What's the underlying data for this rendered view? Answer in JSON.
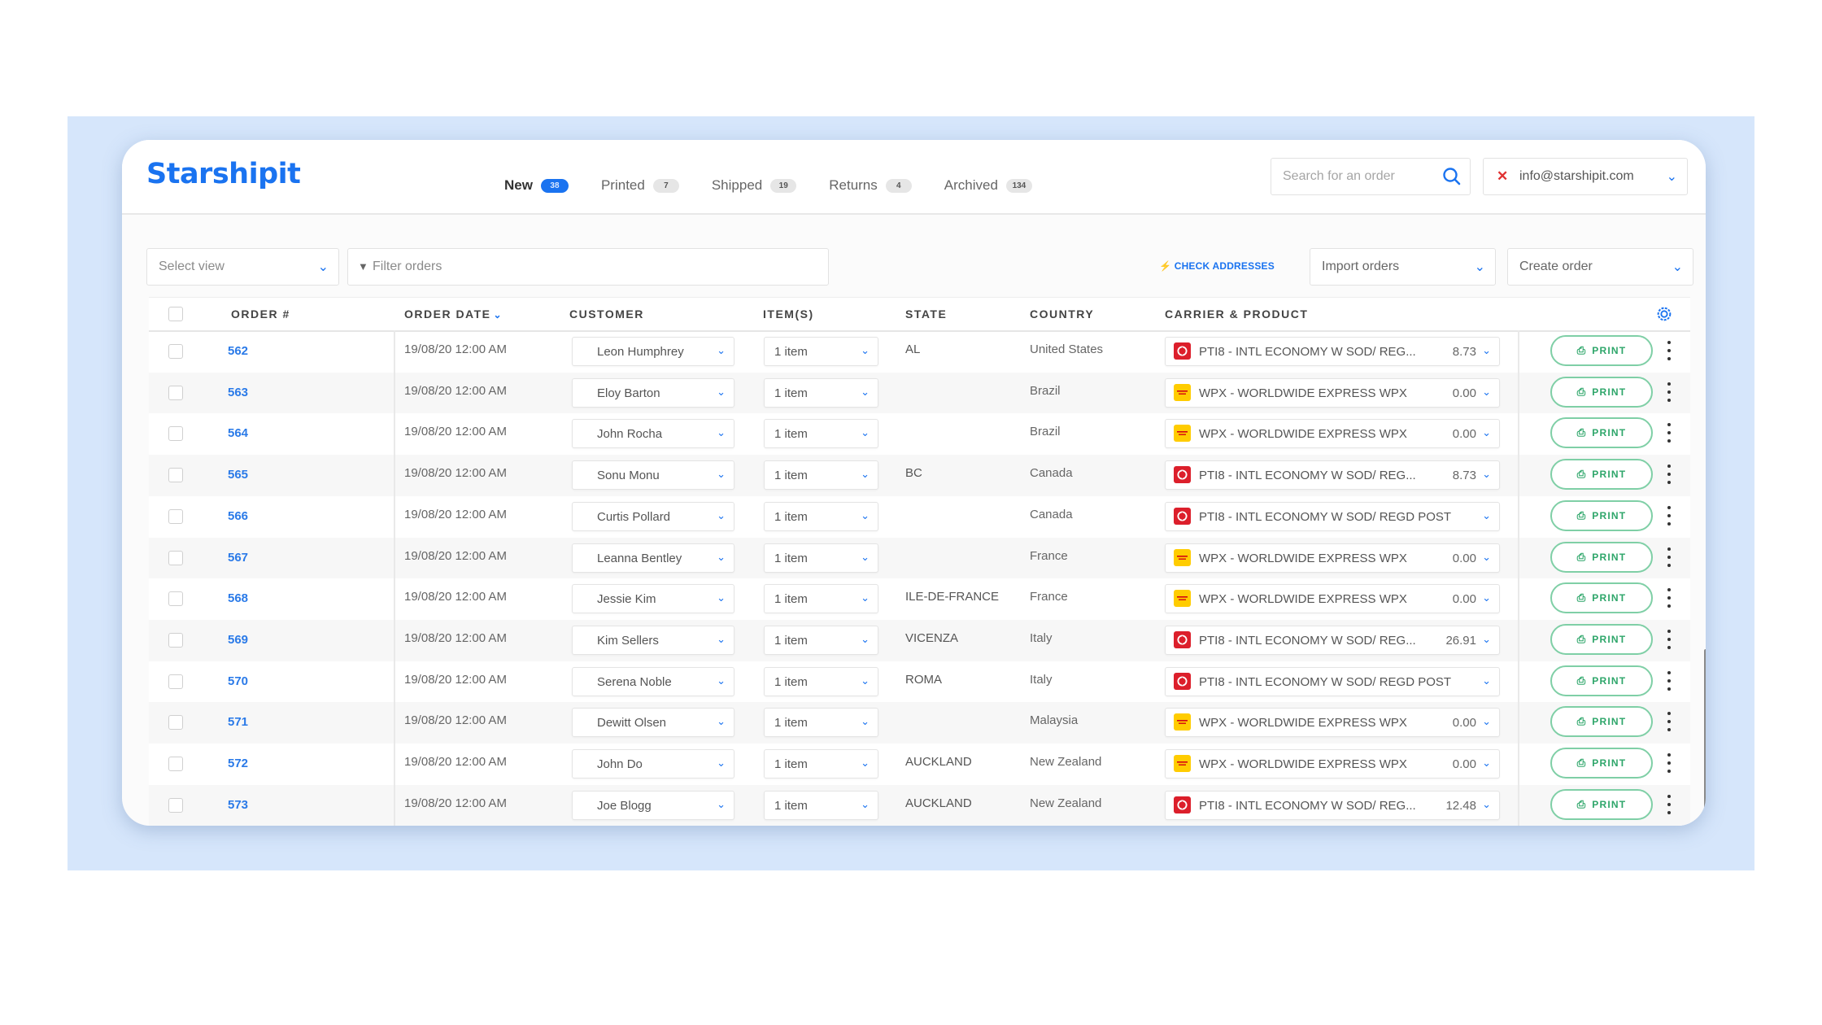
{
  "app": {
    "logo": "Starshipit"
  },
  "tabs": [
    {
      "label": "New",
      "count": "38",
      "active": true
    },
    {
      "label": "Printed",
      "count": "7",
      "active": false
    },
    {
      "label": "Shipped",
      "count": "19",
      "active": false
    },
    {
      "label": "Returns",
      "count": "4",
      "active": false
    },
    {
      "label": "Archived",
      "count": "134",
      "active": false
    }
  ],
  "search": {
    "placeholder": "Search for an order",
    "value": ""
  },
  "account": {
    "email": "info@starshipit.com"
  },
  "toolbar": {
    "select_view": "Select view",
    "filter_placeholder": "Filter orders",
    "check_addresses": "CHECK ADDRESSES",
    "import_orders": "Import orders",
    "create_order": "Create order"
  },
  "table": {
    "columns": [
      "ORDER #",
      "ORDER DATE",
      "CUSTOMER",
      "ITEM(S)",
      "STATE",
      "COUNTRY",
      "CARRIER & PRODUCT"
    ],
    "print_label": "PRINT",
    "rows": [
      {
        "order": "562",
        "date": "19/08/20 12:00 AM",
        "customer": "Leon Humphrey",
        "items": "1 item",
        "state": "AL",
        "country": "United States",
        "carrier": "PTI8 - INTL ECONOMY W SOD/ REG...",
        "carrier_brand": "red",
        "price": "8.73"
      },
      {
        "order": "563",
        "date": "19/08/20 12:00 AM",
        "customer": "Eloy Barton",
        "items": "1 item",
        "state": "",
        "country": "Brazil",
        "carrier": "WPX - WORLDWIDE EXPRESS WPX",
        "carrier_brand": "yellow",
        "price": "0.00"
      },
      {
        "order": "564",
        "date": "19/08/20 12:00 AM",
        "customer": "John Rocha",
        "items": "1 item",
        "state": "",
        "country": "Brazil",
        "carrier": "WPX - WORLDWIDE EXPRESS WPX",
        "carrier_brand": "yellow",
        "price": "0.00"
      },
      {
        "order": "565",
        "date": "19/08/20 12:00 AM",
        "customer": "Sonu Monu",
        "items": "1 item",
        "state": "BC",
        "country": "Canada",
        "carrier": "PTI8 - INTL ECONOMY W SOD/ REG...",
        "carrier_brand": "red",
        "price": "8.73"
      },
      {
        "order": "566",
        "date": "19/08/20 12:00 AM",
        "customer": "Curtis Pollard",
        "items": "1 item",
        "state": "",
        "country": "Canada",
        "carrier": "PTI8 - INTL ECONOMY W SOD/ REGD POST",
        "carrier_brand": "red",
        "price": ""
      },
      {
        "order": "567",
        "date": "19/08/20 12:00 AM",
        "customer": "Leanna Bentley",
        "items": "1 item",
        "state": "",
        "country": "France",
        "carrier": "WPX - WORLDWIDE EXPRESS WPX",
        "carrier_brand": "yellow",
        "price": "0.00"
      },
      {
        "order": "568",
        "date": "19/08/20 12:00 AM",
        "customer": "Jessie Kim",
        "items": "1 item",
        "state": "ILE-DE-FRANCE",
        "country": "France",
        "carrier": "WPX - WORLDWIDE EXPRESS WPX",
        "carrier_brand": "yellow",
        "price": "0.00"
      },
      {
        "order": "569",
        "date": "19/08/20 12:00 AM",
        "customer": "Kim Sellers",
        "items": "1 item",
        "state": "VICENZA",
        "country": "Italy",
        "carrier": "PTI8 - INTL ECONOMY W SOD/ REG...",
        "carrier_brand": "red",
        "price": "26.91"
      },
      {
        "order": "570",
        "date": "19/08/20 12:00 AM",
        "customer": "Serena Noble",
        "items": "1 item",
        "state": "ROMA",
        "country": "Italy",
        "carrier": "PTI8 - INTL ECONOMY W SOD/ REGD POST",
        "carrier_brand": "red",
        "price": ""
      },
      {
        "order": "571",
        "date": "19/08/20 12:00 AM",
        "customer": "Dewitt Olsen",
        "items": "1 item",
        "state": "",
        "country": "Malaysia",
        "carrier": "WPX - WORLDWIDE EXPRESS WPX",
        "carrier_brand": "yellow",
        "price": "0.00"
      },
      {
        "order": "572",
        "date": "19/08/20 12:00 AM",
        "customer": "John Do",
        "items": "1 item",
        "state": "AUCKLAND",
        "country": "New Zealand",
        "carrier": "WPX - WORLDWIDE EXPRESS WPX",
        "carrier_brand": "yellow",
        "price": "0.00"
      },
      {
        "order": "573",
        "date": "19/08/20 12:00 AM",
        "customer": "Joe Blogg",
        "items": "1 item",
        "state": "AUCKLAND",
        "country": "New Zealand",
        "carrier": "PTI8 - INTL ECONOMY W SOD/ REG...",
        "carrier_brand": "red",
        "price": "12.48"
      }
    ]
  },
  "colors": {
    "brand": "#1a73f0",
    "print_green": "#2ea66a",
    "carrier_red": "#dc1f2b",
    "carrier_yellow": "#ffcc00"
  }
}
